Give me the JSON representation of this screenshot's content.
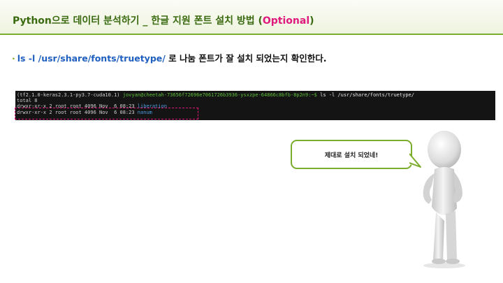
{
  "slide": {
    "title_prefix": "Python으로 데이터 분석하기 _ 한글 지원 폰트 설치 방법 (",
    "title_accent": "Optional",
    "title_suffix": ")",
    "bullet_path": "ls -l /usr/share/fonts/truetype/",
    "bullet_text": " 로 나눔 폰트가 잘 설치 되었는지 확인한다.",
    "speech_bubble": "제대로 설치 되었네!"
  },
  "terminal": {
    "env": "(tf2.1.0-keras2.3.1-py3.7-cuda10.1)",
    "prompt": "jovyan@cheetah-73656f72696e7061726b3936-ysxzpe-64866c8bfb-8p2n9:~$",
    "command": "ls -l /usr/share/fonts/truetype/",
    "total": "total 8",
    "rows": [
      {
        "meta": "drwxr-xr-x 2 root root 4096 Nov  6 08:23",
        "name": "liberation"
      },
      {
        "meta": "drwxr-xr-x 2 root root 4096 Nov  6 08:23",
        "name": "nanum"
      }
    ]
  },
  "colors": {
    "title": "#3b6b10",
    "accent": "#e0197d",
    "green_rule": "#7aad2c",
    "terminal_bg": "#141414",
    "dir_blue": "#4a9fe0"
  },
  "icons": {
    "figure": "3d-person-figure-icon"
  }
}
